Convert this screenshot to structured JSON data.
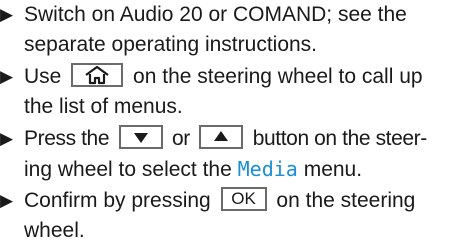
{
  "instructions": [
    {
      "lines": [
        "Switch on Audio 20 or COMAND; see the",
        "separate operating instructions."
      ]
    },
    {
      "line1_prefix": "Use",
      "line1_suffix": "on the steering wheel to call up",
      "line2": "the list of menus.",
      "button_icon": "home-icon"
    },
    {
      "line1_prefix": "Press the",
      "line1_mid": "or",
      "line1_suffix": "button on the steer-",
      "line2_prefix": "ing wheel to select the",
      "line2_highlight": "Media",
      "line2_suffix": "menu.",
      "highlight_color": "#1a8fd6",
      "button_icons": [
        "down-triangle-icon",
        "up-triangle-icon"
      ]
    },
    {
      "line1_prefix": "Confirm by pressing",
      "button_label": "OK",
      "line1_suffix": "on the steering",
      "line2": "wheel."
    }
  ],
  "bullet_glyph": "▶"
}
